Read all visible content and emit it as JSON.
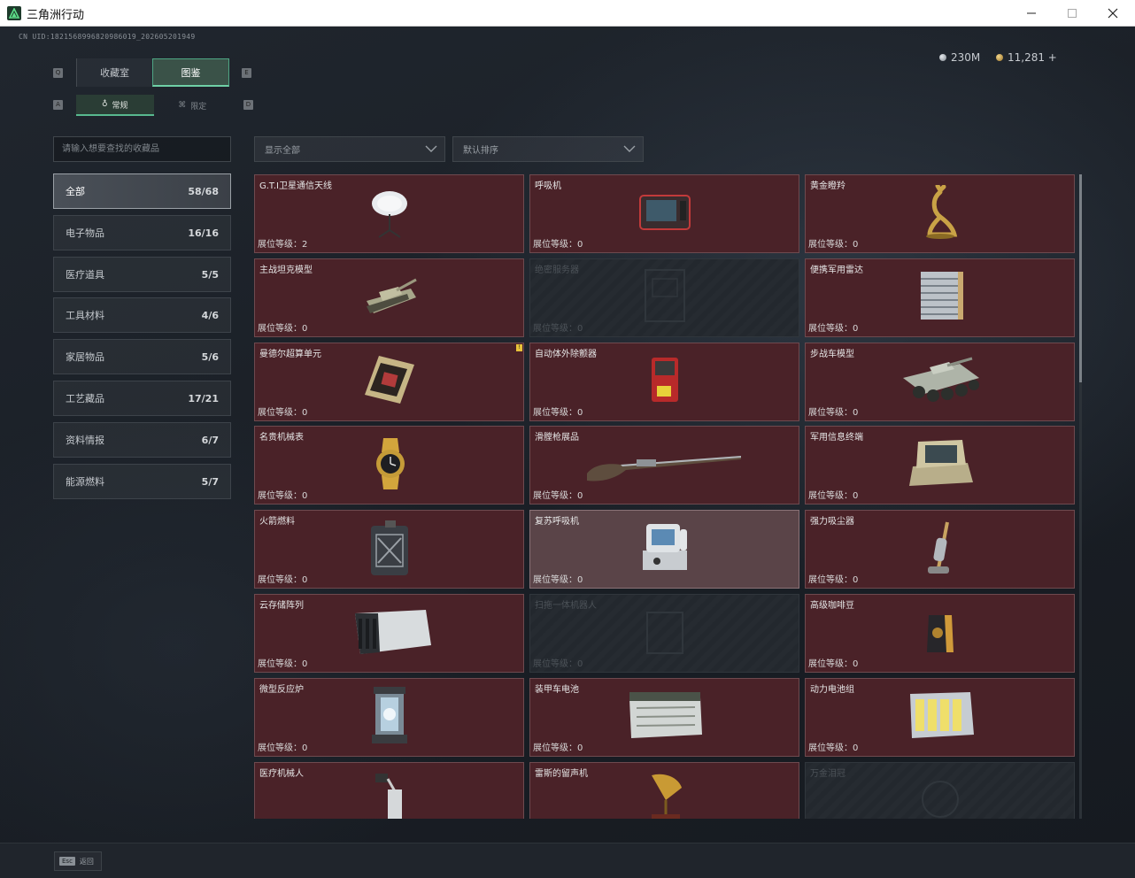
{
  "window": {
    "title": "三角洲行动"
  },
  "header": {
    "uid": "CN UID:1821568996820986019_202605201949",
    "currency": [
      {
        "value": "230M",
        "color": "#b6bcc2"
      },
      {
        "value": "11,281 +",
        "color": "#d4a94c"
      }
    ]
  },
  "tabs": {
    "main": [
      "收藏室",
      "图鉴"
    ],
    "main_active": 1,
    "sub": [
      "常规",
      "限定"
    ],
    "sub_active": 0,
    "key_hints": [
      "Q",
      "E",
      "A",
      "D"
    ]
  },
  "search": {
    "placeholder": "请输入想要查找的收藏品"
  },
  "filters": {
    "display": "显示全部",
    "sort": "默认排序"
  },
  "categories": [
    {
      "label": "全部",
      "count": "58/68",
      "active": true
    },
    {
      "label": "电子物品",
      "count": "16/16"
    },
    {
      "label": "医疗道具",
      "count": "5/5"
    },
    {
      "label": "工具材料",
      "count": "4/6"
    },
    {
      "label": "家居物品",
      "count": "5/6"
    },
    {
      "label": "工艺藏品",
      "count": "17/21"
    },
    {
      "label": "资料情报",
      "count": "6/7"
    },
    {
      "label": "能源燃料",
      "count": "5/7"
    }
  ],
  "items": [
    {
      "name": "G.T.I卫星通信天线",
      "level": "展位等级：2",
      "icon": "satellite-dish-icon"
    },
    {
      "name": "呼吸机",
      "level": "展位等级：0",
      "icon": "ventilator-icon"
    },
    {
      "name": "黄金瞪羚",
      "level": "展位等级：0",
      "icon": "golden-gazelle-icon"
    },
    {
      "name": "主战坦克模型",
      "level": "展位等级：0",
      "icon": "tank-model-icon"
    },
    {
      "name": "绝密服务器",
      "level": "展位等级：0",
      "icon": "server-icon",
      "empty": true
    },
    {
      "name": "便携军用雷达",
      "level": "展位等级：0",
      "icon": "radar-icon"
    },
    {
      "name": "曼德尔超算单元",
      "level": "展位等级：0",
      "icon": "supercomputer-unit-icon",
      "badge": "!"
    },
    {
      "name": "自动体外除颤器",
      "level": "展位等级：0",
      "icon": "defibrillator-icon"
    },
    {
      "name": "步战车模型",
      "level": "展位等级：0",
      "icon": "ifv-model-icon"
    },
    {
      "name": "名贵机械表",
      "level": "展位等级：0",
      "icon": "watch-icon"
    },
    {
      "name": "滑膛枪展品",
      "level": "展位等级：0",
      "icon": "musket-icon"
    },
    {
      "name": "军用信息终端",
      "level": "展位等级：0",
      "icon": "terminal-icon"
    },
    {
      "name": "火箭燃料",
      "level": "展位等级：0",
      "icon": "fuel-can-icon"
    },
    {
      "name": "复苏呼吸机",
      "level": "展位等级：0",
      "icon": "resuscitator-icon",
      "highlight": true
    },
    {
      "name": "强力吸尘器",
      "level": "展位等级：0",
      "icon": "vacuum-icon"
    },
    {
      "name": "云存储阵列",
      "level": "展位等级：0",
      "icon": "storage-array-icon"
    },
    {
      "name": "扫拖一体机器人",
      "level": "展位等级：0",
      "icon": "robot-vacuum-icon",
      "empty": true
    },
    {
      "name": "高级咖啡豆",
      "level": "展位等级：0",
      "icon": "coffee-bag-icon"
    },
    {
      "name": "微型反应炉",
      "level": "展位等级：0",
      "icon": "reactor-icon"
    },
    {
      "name": "装甲车电池",
      "level": "展位等级：0",
      "icon": "battery-icon"
    },
    {
      "name": "动力电池组",
      "level": "展位等级：0",
      "icon": "battery-pack-icon"
    },
    {
      "name": "医疗机械人",
      "level": "",
      "icon": "medical-robot-icon"
    },
    {
      "name": "雷斯的留声机",
      "level": "",
      "icon": "gramophone-icon"
    },
    {
      "name": "万金泪冠",
      "level": "",
      "icon": "crown-icon",
      "empty": true
    }
  ],
  "footer": {
    "esc_key": "Esc",
    "esc_label": "返回"
  }
}
